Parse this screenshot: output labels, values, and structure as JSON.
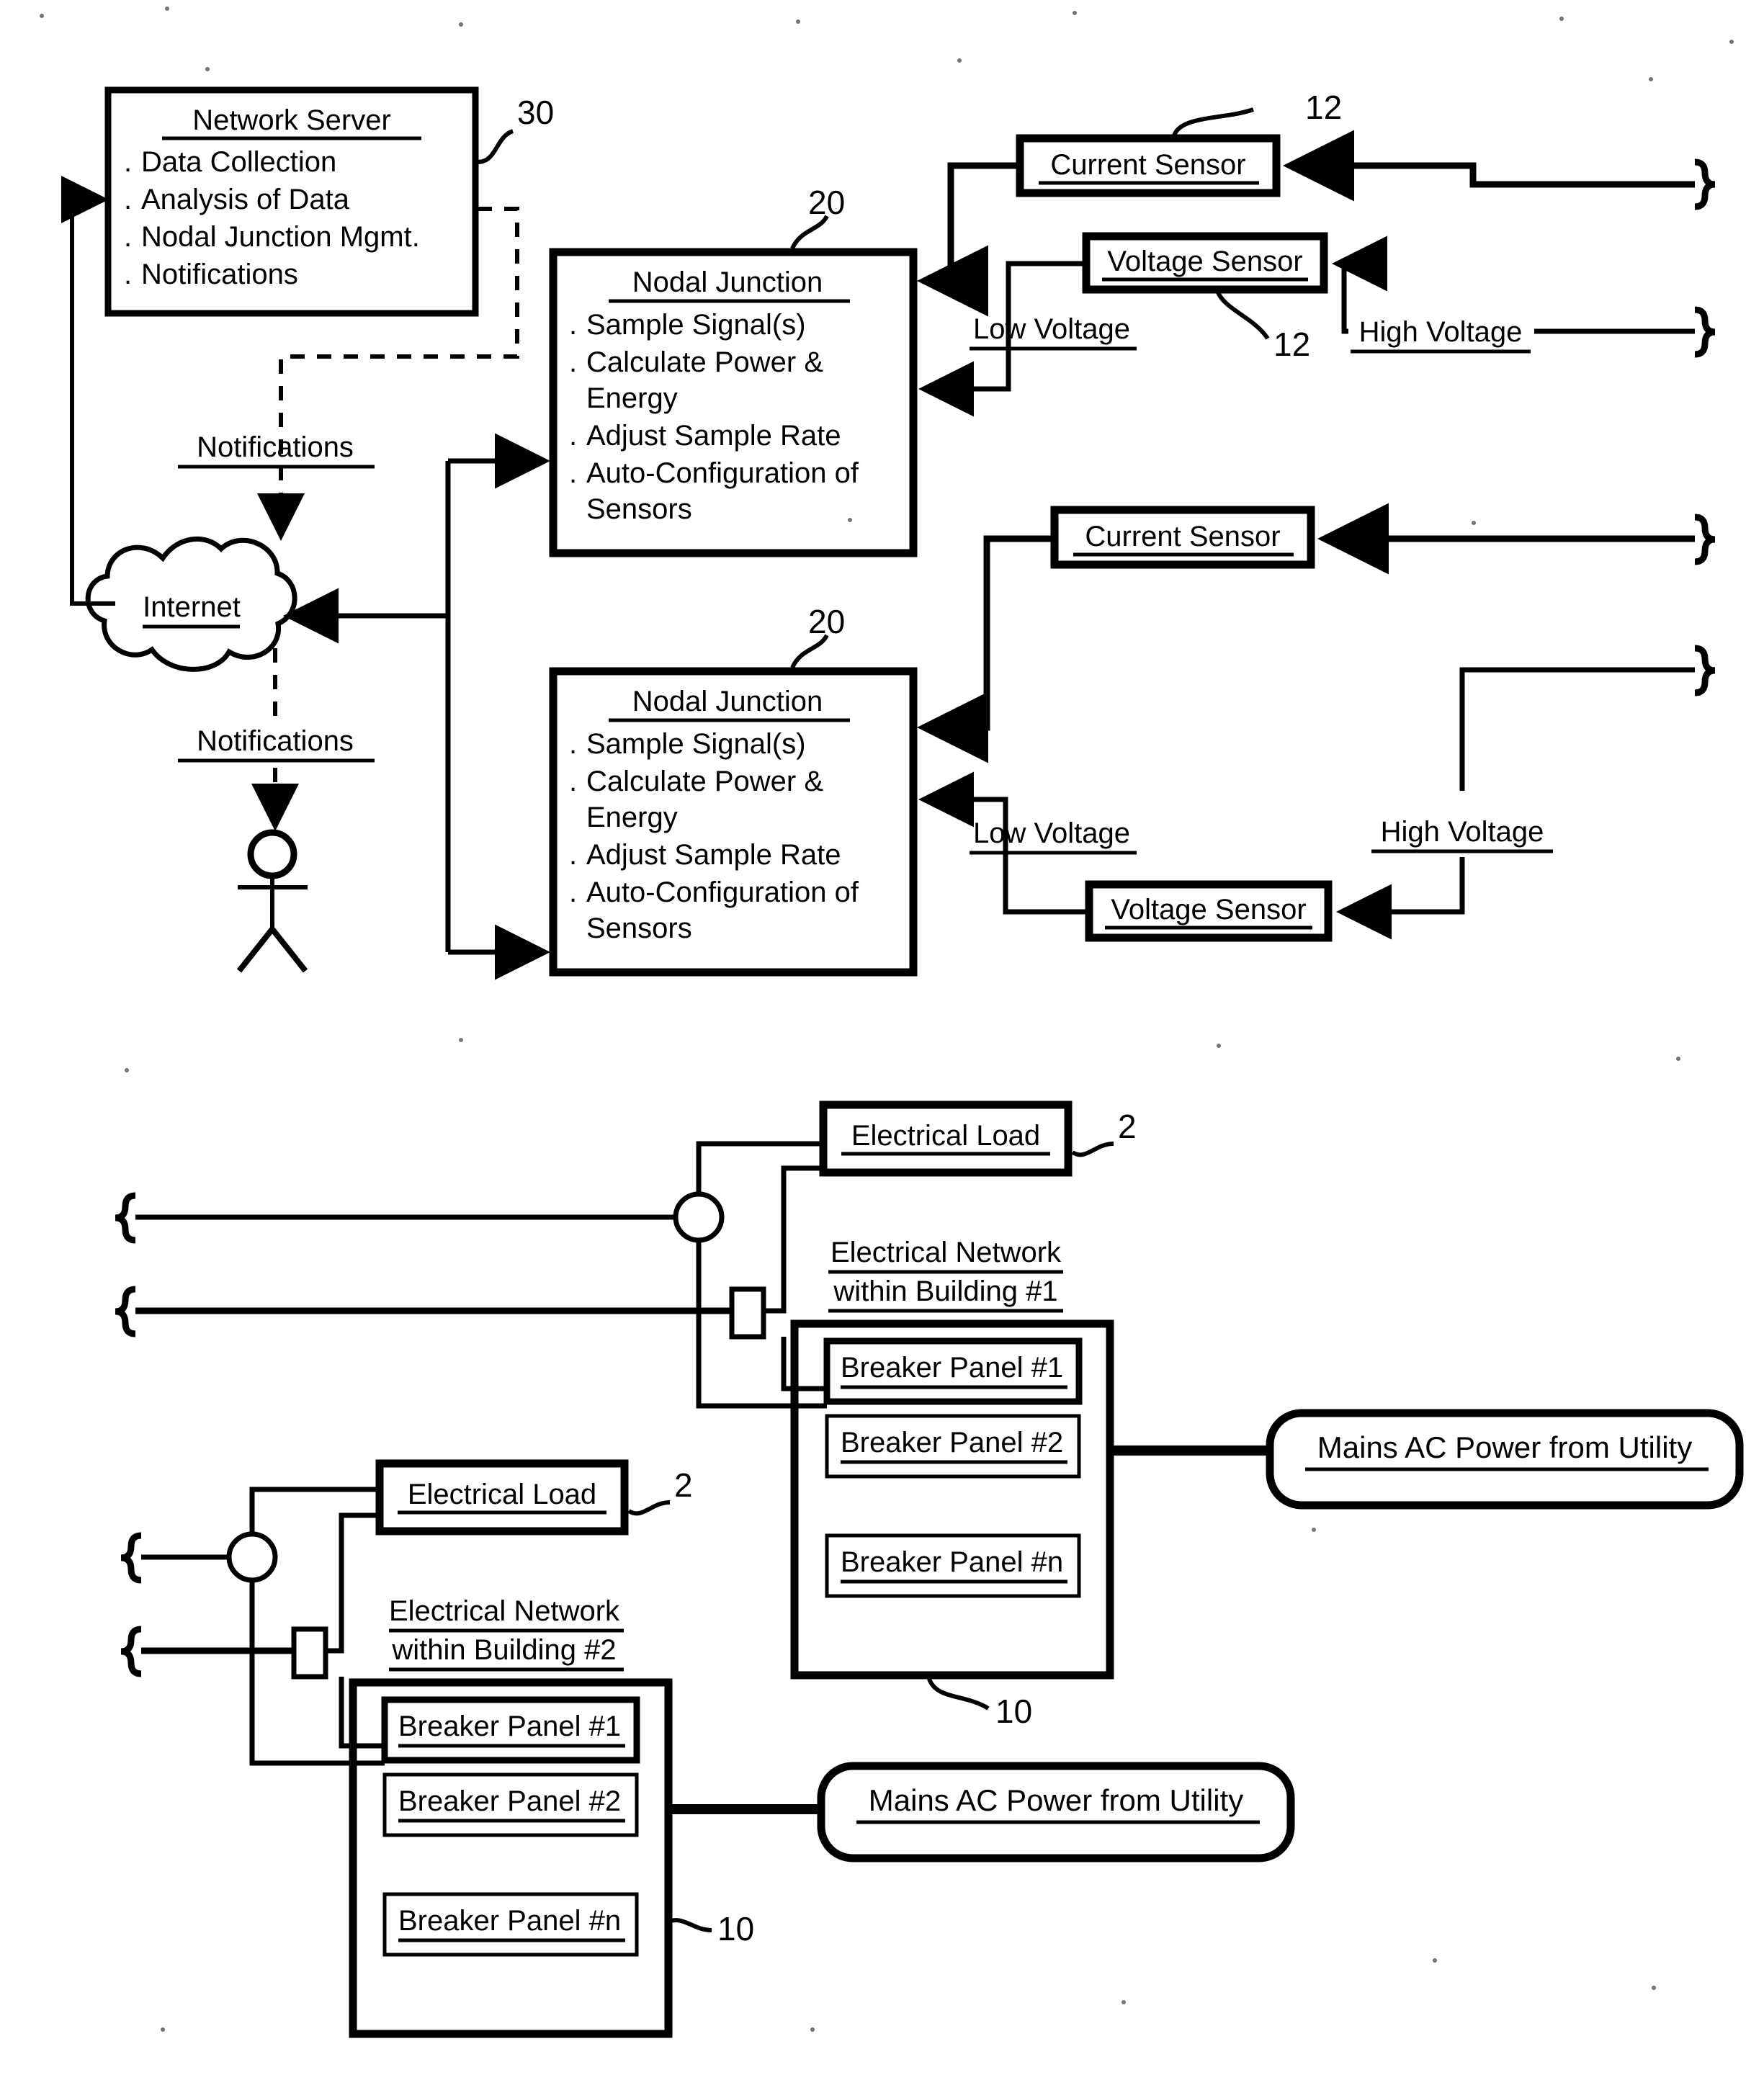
{
  "figure": {
    "top_diagram": {
      "network_server": {
        "title": "Network Server",
        "items": [
          "Data Collection",
          "Analysis of Data",
          "Nodal Junction Mgmt.",
          "Notifications"
        ],
        "ref": "30"
      },
      "nodal_junction_1": {
        "title": "Nodal Junction",
        "items": [
          "Sample Signal(s)",
          "Calculate Power &",
          "Energy",
          "Adjust Sample Rate",
          "Auto-Configuration of",
          "Sensors"
        ],
        "ref": "20"
      },
      "nodal_junction_2": {
        "title": "Nodal Junction",
        "items": [
          "Sample Signal(s)",
          "Calculate Power &",
          "Energy",
          "Adjust Sample Rate",
          "Auto-Configuration of",
          "Sensors"
        ],
        "ref": "20"
      },
      "internet": {
        "label": "Internet"
      },
      "notifications_up": {
        "label": "Notifications"
      },
      "notifications_down": {
        "label": "Notifications"
      },
      "current_sensor_1": {
        "label": "Current Sensor",
        "ref": "12"
      },
      "current_sensor_2": {
        "label": "Current Sensor"
      },
      "voltage_sensor_1": {
        "label": "Voltage Sensor",
        "ref": "12"
      },
      "voltage_sensor_2": {
        "label": "Voltage Sensor"
      },
      "low_voltage_1": {
        "label": "Low Voltage"
      },
      "low_voltage_2": {
        "label": "Low Voltage"
      },
      "high_voltage_1": {
        "label": "High Voltage"
      },
      "high_voltage_2": {
        "label": "High Voltage"
      }
    },
    "bottom_diagram": {
      "electrical_load_1": {
        "label": "Electrical Load",
        "ref": "2"
      },
      "electrical_load_2": {
        "label": "Electrical Load",
        "ref": "2"
      },
      "building_1": {
        "caption_line1": "Electrical Network",
        "caption_line2": "within Building #1",
        "panels": [
          "Breaker Panel #1",
          "Breaker Panel #2",
          "Breaker Panel #n"
        ],
        "ref": "10"
      },
      "building_2": {
        "caption_line1": "Electrical Network",
        "caption_line2": "within Building #2",
        "panels": [
          "Breaker Panel #1",
          "Breaker Panel #2",
          "Breaker Panel #n"
        ],
        "ref": "10"
      },
      "mains_1": {
        "label": "Mains AC Power from Utility"
      },
      "mains_2": {
        "label": "Mains AC Power from Utility"
      }
    }
  },
  "colors": {
    "ink": "#000000",
    "paper": "#ffffff"
  }
}
